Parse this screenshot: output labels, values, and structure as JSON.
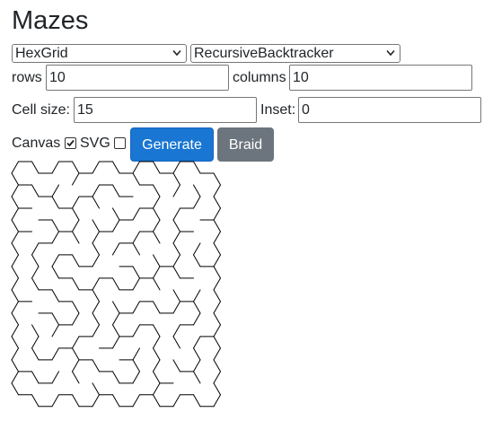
{
  "page": {
    "title": "Mazes"
  },
  "controls": {
    "grid_select": {
      "value": "HexGrid"
    },
    "algorithm_select": {
      "value": "RecursiveBacktracker"
    },
    "rows": {
      "label": "rows",
      "value": "10"
    },
    "columns": {
      "label": "columns",
      "value": "10"
    },
    "cell_size": {
      "label": "Cell size:",
      "value": "15"
    },
    "inset": {
      "label": "Inset:",
      "value": "0"
    },
    "canvas": {
      "label": "Canvas",
      "checked": true
    },
    "svg": {
      "label": "SVG",
      "checked": false
    },
    "generate_label": "Generate",
    "braid_label": "Braid"
  },
  "colors": {
    "primary_button": "#1976d2",
    "secondary_button": "#6c757d",
    "maze_wall": "#000000"
  },
  "maze": {
    "type": "hex",
    "rows": 10,
    "columns": 10,
    "cell_size": 15,
    "inset": 0
  }
}
